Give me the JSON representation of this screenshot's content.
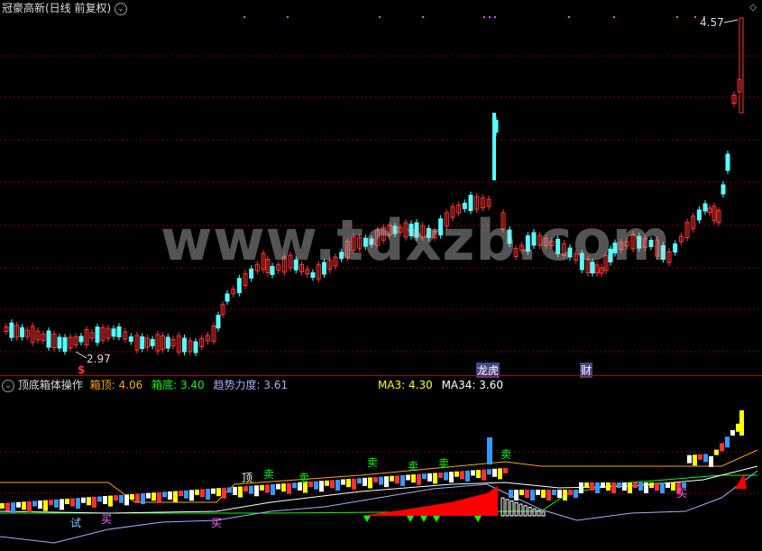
{
  "main": {
    "title": "冠豪高新(日线 前复权)",
    "menu_icon": "chevron-down-circle-icon",
    "high_label": "4.57",
    "low_label": "2.97",
    "marker_dollar": "$",
    "tag_longhu": "龙虎",
    "tag_cai": "财",
    "watermark": "www.tdxzb.com"
  },
  "indicator": {
    "name": "顶底箱体操作",
    "box_top_label": "箱顶:",
    "box_top_value": "4.06",
    "box_bottom_label": "箱底:",
    "box_bottom_value": "3.40",
    "trend_label": "趋势力度:",
    "trend_value": "3.61",
    "ma3_label": "MA3:",
    "ma3_value": "4.30",
    "ma34_label": "MA34:",
    "ma34_value": "3.60",
    "sell_char": "卖",
    "top_char": "顶",
    "buy_char": "买",
    "test_char": "试"
  },
  "colors": {
    "up": "#ff3232",
    "down": "#54ffff",
    "grid": "#8b0000",
    "box_top": "#ffa500",
    "box_bottom": "#00ff00",
    "trend": "#aaaaff",
    "ma3": "#ffff00",
    "ma34": "#ffffff"
  }
}
